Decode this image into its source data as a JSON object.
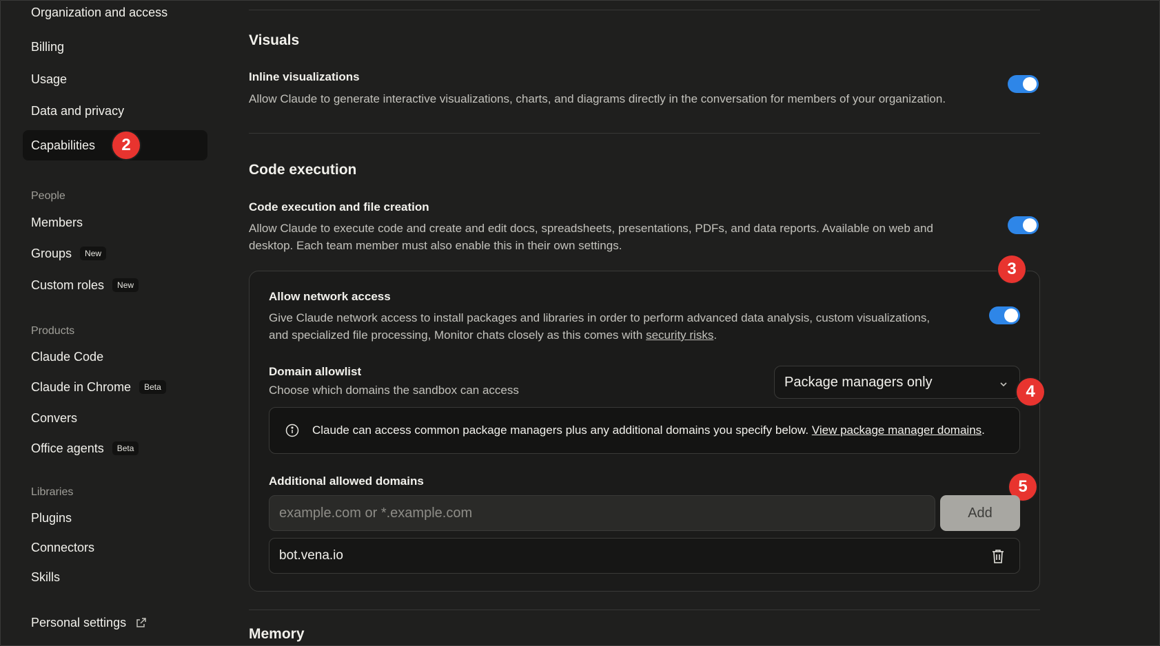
{
  "sidebar": {
    "top_items": [
      {
        "label": "Organization and access"
      },
      {
        "label": "Billing"
      },
      {
        "label": "Usage"
      },
      {
        "label": "Data and privacy"
      },
      {
        "label": "Capabilities",
        "active": true
      }
    ],
    "people_section": "People",
    "people_items": [
      {
        "label": "Members",
        "badge": ""
      },
      {
        "label": "Groups",
        "badge": "New"
      },
      {
        "label": "Custom roles",
        "badge": "New"
      }
    ],
    "products_section": "Products",
    "products_items": [
      {
        "label": "Claude Code",
        "badge": ""
      },
      {
        "label": "Claude in Chrome",
        "badge": "Beta"
      },
      {
        "label": "Convers",
        "badge": ""
      },
      {
        "label": "Office agents",
        "badge": "Beta"
      }
    ],
    "libraries_section": "Libraries",
    "libraries_items": [
      {
        "label": "Plugins"
      },
      {
        "label": "Connectors"
      },
      {
        "label": "Skills"
      }
    ],
    "personal_settings": "Personal settings",
    "icons": {
      "personal_settings": "external-link-icon"
    }
  },
  "markers": {
    "m2": "2",
    "m3": "3",
    "m4": "4",
    "m5": "5"
  },
  "visuals": {
    "title": "Visuals",
    "inline_title": "Inline visualizations",
    "inline_desc": "Allow Claude to generate interactive visualizations, charts, and diagrams directly in the conversation for members of your organization.",
    "inline_enabled": true
  },
  "code_execution": {
    "title": "Code execution",
    "setting_title": "Code execution and file creation",
    "setting_desc_line1": "Allow Claude to execute code and create and edit docs, spreadsheets, presentations, PDFs, and data reports. Available on web and",
    "setting_desc_line2": "desktop. Each team member must also enable this in their own settings.",
    "enabled": true,
    "network": {
      "title": "Allow network access",
      "desc_line1": "Give Claude network access to install packages and libraries in order to perform advanced data analysis, custom visualizations,",
      "desc_line2_prefix": "and specialized file processing, Monitor chats closely as this comes with ",
      "desc_link": "security risks",
      "desc_suffix": ".",
      "enabled": true,
      "allowlist_title": "Domain allowlist",
      "allowlist_desc": "Choose which domains the sandbox can access",
      "allowlist_selected": "Package managers only",
      "info_text": "Claude can access common package managers plus any additional domains you specify below. ",
      "info_link": "View package manager domains",
      "info_suffix": ".",
      "additional_title": "Additional allowed domains",
      "input_placeholder": "example.com or *.example.com",
      "input_value": "",
      "add_label": "Add",
      "domains": [
        "bot.vena.io"
      ]
    }
  },
  "memory": {
    "title": "Memory"
  },
  "colors": {
    "accent": "#2e86e8",
    "marker": "#e8342f",
    "background": "#1f1f1e"
  }
}
